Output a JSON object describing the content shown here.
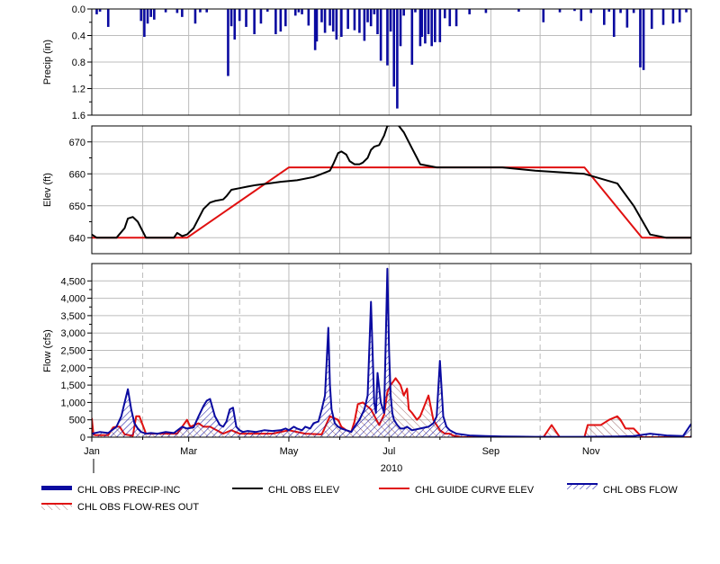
{
  "colors": {
    "precip": "#0a0aa0",
    "elev": "#000000",
    "guide": "#e01010",
    "flow": "#0a0aa0",
    "res_out": "#e01010",
    "grid": "#bcbcbc",
    "frame": "#000000"
  },
  "chart_data": [
    {
      "type": "bar",
      "panel": "precip",
      "ylabel": "Precip (in)",
      "y_inverted": true,
      "ylim": [
        0,
        1.6
      ],
      "yticks": [
        0.0,
        0.4,
        0.8,
        1.2,
        1.6
      ],
      "ytick_labels": [
        "0.0",
        "0.4",
        "0.8",
        "1.2",
        "1.6"
      ],
      "xlim": [
        0,
        365
      ],
      "x_unit": "day of 2010",
      "series": [
        {
          "name": "CHL OBS PRECIP-INC",
          "x": [
            3,
            5,
            10,
            30,
            32,
            34,
            36,
            38,
            45,
            52,
            55,
            63,
            66,
            70,
            83,
            85,
            87,
            90,
            94,
            99,
            103,
            107,
            112,
            115,
            118,
            124,
            126,
            128,
            132,
            136,
            137,
            140,
            142,
            145,
            147,
            149,
            152,
            156,
            160,
            163,
            166,
            168,
            170,
            172,
            174,
            176,
            180,
            182,
            184,
            186,
            188,
            190,
            195,
            197,
            200,
            201,
            203,
            205,
            207,
            209,
            212,
            215,
            218,
            222,
            230,
            240,
            260,
            275,
            285,
            294,
            298,
            304,
            312,
            315,
            318,
            322,
            326,
            330,
            334,
            336,
            341,
            348,
            354,
            358,
            362
          ],
          "values": [
            0.08,
            0.04,
            0.27,
            0.18,
            0.42,
            0.22,
            0.12,
            0.16,
            0.05,
            0.06,
            0.12,
            0.22,
            0.05,
            0.05,
            1.01,
            0.26,
            0.46,
            0.18,
            0.27,
            0.38,
            0.22,
            0.04,
            0.38,
            0.34,
            0.26,
            0.1,
            0.05,
            0.08,
            0.25,
            0.62,
            0.49,
            0.2,
            0.36,
            0.25,
            0.34,
            0.46,
            0.42,
            0.3,
            0.32,
            0.36,
            0.48,
            0.2,
            0.26,
            0.08,
            0.38,
            0.78,
            0.85,
            0.34,
            1.17,
            1.5,
            0.56,
            0.1,
            0.84,
            0.05,
            0.56,
            0.42,
            0.52,
            0.38,
            0.56,
            0.5,
            0.5,
            0.14,
            0.26,
            0.26,
            0.08,
            0.06,
            0.04,
            0.2,
            0.05,
            0.03,
            0.18,
            0.06,
            0.24,
            0.04,
            0.42,
            0.06,
            0.28,
            0.06,
            0.88,
            0.92,
            0.3,
            0.24,
            0.22,
            0.2,
            0.05
          ]
        }
      ]
    },
    {
      "type": "line",
      "panel": "elev",
      "ylabel": "Elev (ft)",
      "ylim": [
        635,
        675
      ],
      "yticks": [
        640,
        650,
        660,
        670
      ],
      "ytick_labels": [
        "640",
        "650",
        "660",
        "670"
      ],
      "xlim": [
        0,
        365
      ],
      "x_unit": "day of 2010",
      "series": [
        {
          "name": "CHL OBS ELEV",
          "x": [
            0,
            3,
            15,
            20,
            22,
            25,
            28,
            33,
            50,
            52,
            55,
            58,
            62,
            65,
            68,
            72,
            75,
            80,
            82,
            85,
            90,
            95,
            100,
            108,
            115,
            125,
            135,
            140,
            145,
            147,
            150,
            152,
            155,
            157,
            160,
            163,
            165,
            168,
            170,
            172,
            175,
            178,
            180,
            185,
            187,
            190,
            192,
            195,
            198,
            200,
            205,
            210,
            230,
            250,
            270,
            300,
            320,
            330,
            340,
            350,
            365
          ],
          "values": [
            641,
            640,
            640,
            643,
            646,
            646.5,
            645,
            640,
            640,
            641.5,
            640.5,
            641,
            643,
            646,
            649,
            651,
            651.5,
            652,
            653,
            655,
            655.5,
            656,
            656.5,
            657,
            657.5,
            658,
            659,
            660,
            661,
            663,
            666.5,
            667,
            666,
            664,
            663,
            663,
            663.5,
            665,
            667.5,
            668.5,
            669,
            672,
            675,
            675.5,
            675,
            673,
            671,
            668,
            665,
            663,
            662.5,
            662,
            662,
            662,
            661,
            660,
            657,
            650,
            641,
            640,
            640
          ]
        },
        {
          "name": "CHL GUIDE CURVE ELEV",
          "x": [
            0,
            58,
            120,
            300,
            335,
            365
          ],
          "values": [
            640,
            640,
            662,
            662,
            640,
            640
          ]
        }
      ]
    },
    {
      "type": "area",
      "panel": "flow",
      "ylabel": "Flow (cfs)",
      "ylim": [
        0,
        5000
      ],
      "yticks": [
        0,
        500,
        1000,
        1500,
        2000,
        2500,
        3000,
        3500,
        4000,
        4500
      ],
      "ytick_labels": [
        "0",
        "500",
        "1,000",
        "1,500",
        "2,000",
        "2,500",
        "3,000",
        "3,500",
        "4,000",
        "4,500"
      ],
      "xlim": [
        0,
        365
      ],
      "x_unit": "day of 2010",
      "x_tick_labels": [
        "Jan",
        "Mar",
        "May",
        "Jul",
        "Sep",
        "Nov"
      ],
      "x_tick_days": [
        0,
        59,
        120,
        181,
        243,
        304
      ],
      "x_minor_days": [
        31,
        90,
        151,
        212,
        273,
        334
      ],
      "year_label": "2010",
      "series": [
        {
          "name": "CHL OBS FLOW",
          "x": [
            0,
            5,
            10,
            15,
            18,
            20,
            22,
            24,
            26,
            28,
            30,
            33,
            36,
            40,
            45,
            50,
            55,
            58,
            62,
            65,
            68,
            70,
            72,
            75,
            78,
            80,
            82,
            84,
            86,
            88,
            90,
            92,
            95,
            100,
            105,
            110,
            115,
            118,
            120,
            123,
            125,
            128,
            130,
            133,
            135,
            138,
            140,
            142,
            144,
            145,
            146,
            148,
            150,
            152,
            155,
            158,
            160,
            163,
            166,
            168,
            170,
            172,
            173,
            174,
            176,
            178,
            180,
            181,
            182,
            183,
            184,
            186,
            188,
            190,
            192,
            195,
            200,
            205,
            208,
            210,
            212,
            214,
            216,
            218,
            220,
            222,
            225,
            230,
            240,
            250,
            260,
            270,
            280,
            290,
            300,
            310,
            320,
            330,
            340,
            350,
            360,
            365
          ],
          "values": [
            100,
            150,
            120,
            300,
            600,
            1000,
            1380,
            800,
            400,
            250,
            150,
            100,
            120,
            100,
            150,
            120,
            300,
            250,
            280,
            600,
            900,
            1050,
            1100,
            600,
            350,
            300,
            450,
            800,
            850,
            300,
            200,
            150,
            180,
            150,
            200,
            180,
            200,
            250,
            200,
            300,
            250,
            200,
            300,
            250,
            400,
            450,
            800,
            1200,
            3150,
            1500,
            800,
            400,
            300,
            250,
            200,
            150,
            300,
            500,
            800,
            1200,
            3900,
            1000,
            700,
            1850,
            1000,
            700,
            4850,
            2500,
            1200,
            700,
            500,
            350,
            250,
            250,
            300,
            200,
            250,
            300,
            400,
            600,
            2200,
            600,
            300,
            200,
            150,
            100,
            80,
            50,
            30,
            20,
            15,
            10,
            10,
            10,
            10,
            15,
            20,
            30,
            100,
            50,
            30,
            380
          ]
        },
        {
          "name": "CHL OBS FLOW-RES OUT",
          "x": [
            0,
            1,
            2,
            4,
            10,
            13,
            15,
            17,
            20,
            25,
            27,
            29,
            33,
            38,
            43,
            48,
            52,
            55,
            58,
            60,
            65,
            68,
            72,
            80,
            85,
            90,
            95,
            110,
            120,
            130,
            140,
            145,
            150,
            152,
            155,
            158,
            160,
            162,
            165,
            170,
            175,
            178,
            180,
            182,
            185,
            188,
            190,
            192,
            193,
            195,
            198,
            200,
            205,
            208,
            212,
            215,
            218,
            220,
            225,
            235,
            245,
            255,
            265,
            275,
            280,
            285,
            290,
            295,
            300,
            302,
            305,
            310,
            315,
            320,
            322,
            325,
            330,
            335,
            345,
            355,
            365
          ],
          "values": [
            550,
            80,
            60,
            60,
            60,
            280,
            300,
            300,
            80,
            40,
            600,
            600,
            100,
            100,
            100,
            100,
            100,
            300,
            500,
            300,
            400,
            300,
            300,
            100,
            200,
            100,
            100,
            100,
            200,
            100,
            80,
            600,
            500,
            300,
            200,
            150,
            450,
            950,
            1000,
            800,
            350,
            650,
            1300,
            1500,
            1700,
            1500,
            1200,
            1400,
            800,
            700,
            500,
            600,
            1200,
            500,
            200,
            100,
            100,
            50,
            0,
            0,
            0,
            0,
            0,
            0,
            350,
            0,
            0,
            0,
            0,
            350,
            350,
            350,
            500,
            600,
            500,
            250,
            250,
            0,
            0,
            0,
            0
          ]
        }
      ]
    }
  ],
  "legend": [
    {
      "label": "CHL OBS PRECIP-INC",
      "swatch": "thick-bar"
    },
    {
      "label": "CHL OBS ELEV",
      "swatch": "black-line"
    },
    {
      "label": "CHL GUIDE CURVE ELEV",
      "swatch": "red-line"
    },
    {
      "label": "CHL OBS FLOW",
      "swatch": "blue-hatch"
    },
    {
      "label": "CHL OBS FLOW-RES OUT",
      "swatch": "red-hatch"
    }
  ]
}
